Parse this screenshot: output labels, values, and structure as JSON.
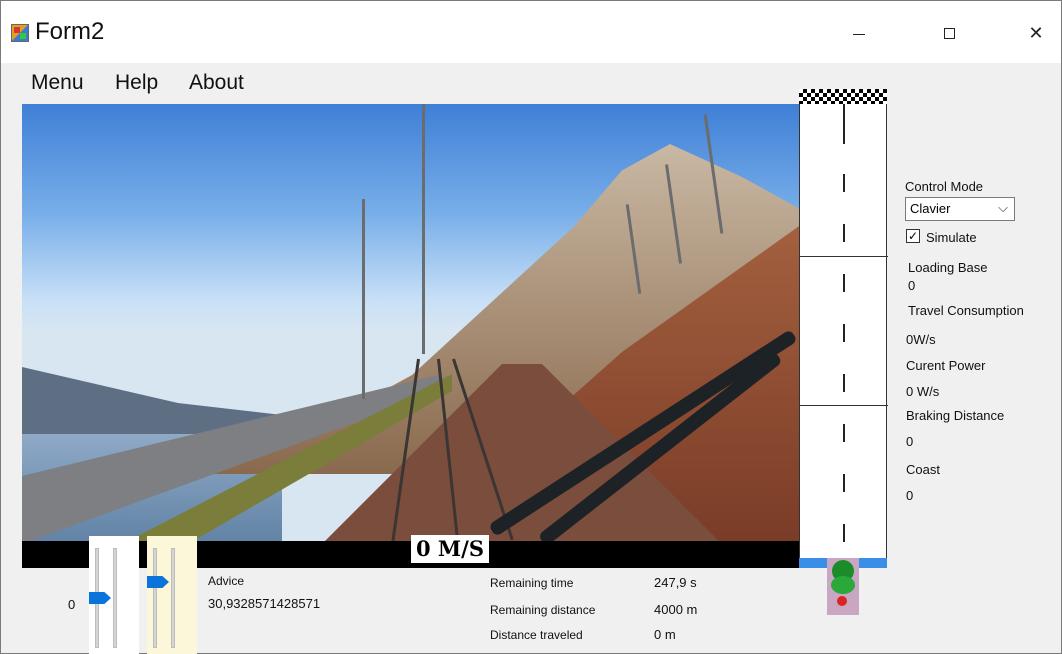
{
  "window": {
    "title": "Form2",
    "minimize": "—",
    "maximize": "☐",
    "close": "✕"
  },
  "menu": {
    "items": [
      "Menu",
      "Help",
      "About"
    ]
  },
  "video": {
    "speed_text": "0 M/S"
  },
  "panel": {
    "control_mode_label": "Control Mode",
    "control_mode_value": "Clavier",
    "simulate_label": "Simulate",
    "simulate_checked": true,
    "loading_base_label": "Loading Base",
    "loading_base_value": "0",
    "travel_consumption_label": "Travel Consumption",
    "travel_consumption_value": "0W/s",
    "current_power_label": "Curent Power",
    "current_power_value": "0 W/s",
    "braking_distance_label": "Braking Distance",
    "braking_distance_value": "0",
    "coast_label": "Coast",
    "coast_value": "0"
  },
  "bottom": {
    "slider_value": "0",
    "advice_label": "Advice",
    "advice_value": "30,9328571428571",
    "remaining_time_label": "Remaining time",
    "remaining_time_value": "247,9 s",
    "remaining_distance_label": "Remaining distance",
    "remaining_distance_value": "4000 m",
    "distance_traveled_label": "Distance traveled",
    "distance_traveled_value": "0 m"
  },
  "colors": {
    "accent_blue": "#3b8ee8",
    "slider_thumb": "#0a74da",
    "highlight_yellow": "#fbf7d8"
  }
}
